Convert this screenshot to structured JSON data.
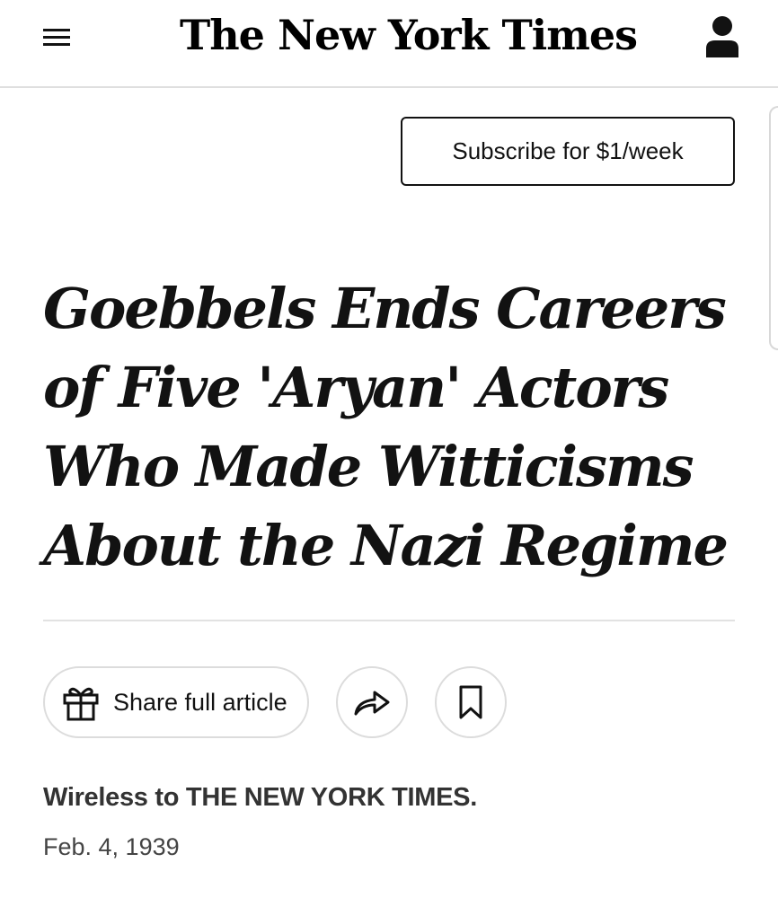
{
  "header": {
    "logo_text": "The New York Times",
    "menu_icon": "hamburger-menu-icon",
    "account_icon": "user-account-icon"
  },
  "subscribe": {
    "label": "Subscribe for $1/week"
  },
  "article": {
    "headline": "Goebbels Ends Careers of Five 'Aryan' Actors Who Made Witticisms About the Nazi Regime",
    "byline": "Wireless to THE NEW YORK TIMES.",
    "date": "Feb. 4, 1939"
  },
  "actions": {
    "share_label": "Share full article",
    "share_icon": "gift-icon",
    "forward_icon": "share-arrow-icon",
    "save_icon": "bookmark-icon"
  },
  "colors": {
    "text": "#121212",
    "divider": "#e2e2e2",
    "button_border": "#dcdcdc"
  }
}
